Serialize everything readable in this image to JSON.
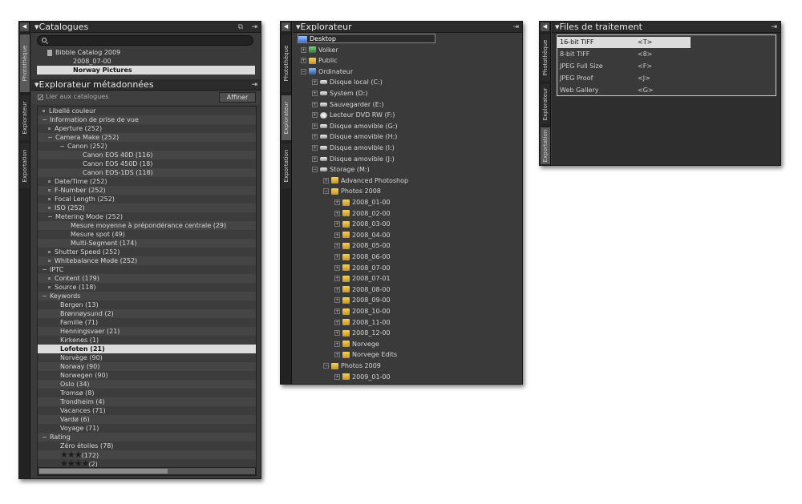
{
  "colors": {
    "panel_bg": "#3a3a3a",
    "header_bg": "#2b2b2b",
    "selection": "#dcdcdc",
    "folder": "#e8b63c"
  },
  "icons": {
    "collapse": "◀",
    "pin": "⇥",
    "copy": "⧉",
    "search": "magnifier"
  },
  "sidetabs": {
    "phototheque": "Photothèque",
    "explorateur": "Explorateur",
    "exportation": "Exportation"
  },
  "catalogues": {
    "title": "Catalogues",
    "items": [
      {
        "label": "Bibble Catalog 2009"
      },
      {
        "label": "2008_07-00"
      },
      {
        "label": "Norway Pictures",
        "selected": true
      }
    ]
  },
  "metadata": {
    "title": "Explorateur métadonnées",
    "link_label": "Lier aux catalogues",
    "refine_label": "Affiner",
    "rows": [
      {
        "label": "Libellé couleur",
        "level": 0,
        "marker": "bullet"
      },
      {
        "label": "Information de prise de vue",
        "level": 0,
        "marker": "minus"
      },
      {
        "label": "Aperture (252)",
        "level": 1,
        "marker": "bullet"
      },
      {
        "label": "Camera Make (252)",
        "level": 1,
        "marker": "minus"
      },
      {
        "label": "Canon (252)",
        "level": 2,
        "marker": "minus"
      },
      {
        "label": "Canon EOS 40D (116)",
        "level": 3,
        "marker": ""
      },
      {
        "label": "Canon EOS 450D (18)",
        "level": 3,
        "marker": ""
      },
      {
        "label": "Canon EOS-1DS (118)",
        "level": 3,
        "marker": ""
      },
      {
        "label": "Date/Time (252)",
        "level": 1,
        "marker": "bullet"
      },
      {
        "label": "F-Number (252)",
        "level": 1,
        "marker": "bullet"
      },
      {
        "label": "Focal Length (252)",
        "level": 1,
        "marker": "bullet"
      },
      {
        "label": "ISO (252)",
        "level": 1,
        "marker": "bullet"
      },
      {
        "label": "Metering Mode (252)",
        "level": 1,
        "marker": "minus"
      },
      {
        "label": "Mesure moyenne à prépondérance centrale (29)",
        "level": 2,
        "marker": ""
      },
      {
        "label": "Mesure spot (49)",
        "level": 2,
        "marker": ""
      },
      {
        "label": "Multi-Segment (174)",
        "level": 2,
        "marker": ""
      },
      {
        "label": "Shutter Speed (252)",
        "level": 1,
        "marker": "bullet"
      },
      {
        "label": "Whitebalance Mode (252)",
        "level": 1,
        "marker": "bullet"
      },
      {
        "label": "IPTC",
        "level": 0,
        "marker": "minus"
      },
      {
        "label": "Content (179)",
        "level": 1,
        "marker": "bullet"
      },
      {
        "label": "Source (118)",
        "level": 1,
        "marker": "bullet"
      },
      {
        "label": "Keywords",
        "level": 0,
        "marker": "minus"
      },
      {
        "label": "Bergen (13)",
        "level": 1,
        "marker": ""
      },
      {
        "label": "Brønnøysund (2)",
        "level": 1,
        "marker": ""
      },
      {
        "label": "Famille (71)",
        "level": 1,
        "marker": ""
      },
      {
        "label": "Henningsvaer (21)",
        "level": 1,
        "marker": ""
      },
      {
        "label": "Kirkenes (1)",
        "level": 1,
        "marker": ""
      },
      {
        "label": "Lofoten (21)",
        "level": 1,
        "marker": "",
        "selected": true
      },
      {
        "label": "Norvège (90)",
        "level": 1,
        "marker": ""
      },
      {
        "label": "Norway (90)",
        "level": 1,
        "marker": ""
      },
      {
        "label": "Norwegen (90)",
        "level": 1,
        "marker": ""
      },
      {
        "label": "Oslo (34)",
        "level": 1,
        "marker": ""
      },
      {
        "label": "Tromsø (8)",
        "level": 1,
        "marker": ""
      },
      {
        "label": "Trondheim (4)",
        "level": 1,
        "marker": ""
      },
      {
        "label": "Vacances (71)",
        "level": 1,
        "marker": ""
      },
      {
        "label": "Vardø (6)",
        "level": 1,
        "marker": ""
      },
      {
        "label": "Voyage (71)",
        "level": 1,
        "marker": ""
      },
      {
        "label": "Rating",
        "level": 0,
        "marker": "minus"
      },
      {
        "label": "Zéro étoiles (78)",
        "level": 1,
        "marker": ""
      },
      {
        "label": "(172)",
        "level": 1,
        "marker": "",
        "stars": 3
      },
      {
        "label": "(2)",
        "level": 1,
        "marker": "",
        "stars": 4
      }
    ]
  },
  "explorer": {
    "title": "Explorateur",
    "items": [
      {
        "label": "Desktop",
        "depth": 0,
        "icon": "desk",
        "toggle": "",
        "selected": true
      },
      {
        "label": "Volker",
        "depth": 1,
        "icon": "user",
        "toggle": "+"
      },
      {
        "label": "Public",
        "depth": 1,
        "icon": "folder",
        "toggle": "+"
      },
      {
        "label": "Ordinateur",
        "depth": 1,
        "icon": "pc",
        "toggle": "-"
      },
      {
        "label": "Disque local (C:)",
        "depth": 2,
        "icon": "drive",
        "toggle": "+"
      },
      {
        "label": "System (D:)",
        "depth": 2,
        "icon": "drive",
        "toggle": "+"
      },
      {
        "label": "Sauvegarder (E:)",
        "depth": 2,
        "icon": "drive",
        "toggle": "+"
      },
      {
        "label": "Lecteur DVD RW (F:)",
        "depth": 2,
        "icon": "disc",
        "toggle": "+"
      },
      {
        "label": "Disque amovible (G:)",
        "depth": 2,
        "icon": "drive",
        "toggle": "+"
      },
      {
        "label": "Disque amovible (H:)",
        "depth": 2,
        "icon": "drive",
        "toggle": "+"
      },
      {
        "label": "Disque amovible (I:)",
        "depth": 2,
        "icon": "drive",
        "toggle": "+"
      },
      {
        "label": "Disque amovible (J:)",
        "depth": 2,
        "icon": "drive",
        "toggle": "+"
      },
      {
        "label": "Storage (M:)",
        "depth": 2,
        "icon": "drive",
        "toggle": "-"
      },
      {
        "label": "Advanced Photoshop",
        "depth": 3,
        "icon": "folder",
        "toggle": "+"
      },
      {
        "label": "Photos 2008",
        "depth": 3,
        "icon": "folder",
        "toggle": "-"
      },
      {
        "label": "2008_01-00",
        "depth": 4,
        "icon": "folder",
        "toggle": "+"
      },
      {
        "label": "2008_02-00",
        "depth": 4,
        "icon": "folder",
        "toggle": "+"
      },
      {
        "label": "2008_03-00",
        "depth": 4,
        "icon": "folder",
        "toggle": "+"
      },
      {
        "label": "2008_04-00",
        "depth": 4,
        "icon": "folder",
        "toggle": "+"
      },
      {
        "label": "2008_05-00",
        "depth": 4,
        "icon": "folder",
        "toggle": "+"
      },
      {
        "label": "2008_06-00",
        "depth": 4,
        "icon": "folder",
        "toggle": "+"
      },
      {
        "label": "2008_07-00",
        "depth": 4,
        "icon": "folder",
        "toggle": "+"
      },
      {
        "label": "2008_07-01",
        "depth": 4,
        "icon": "folder",
        "toggle": "+"
      },
      {
        "label": "2008_08-00",
        "depth": 4,
        "icon": "folder",
        "toggle": "+"
      },
      {
        "label": "2008_09-00",
        "depth": 4,
        "icon": "folder",
        "toggle": "+"
      },
      {
        "label": "2008_10-00",
        "depth": 4,
        "icon": "folder",
        "toggle": "+"
      },
      {
        "label": "2008_11-00",
        "depth": 4,
        "icon": "folder",
        "toggle": "+"
      },
      {
        "label": "2008_12-00",
        "depth": 4,
        "icon": "folder",
        "toggle": "+"
      },
      {
        "label": "Norvege",
        "depth": 4,
        "icon": "folder",
        "toggle": "+"
      },
      {
        "label": "Norvege Edits",
        "depth": 4,
        "icon": "folder",
        "toggle": "+"
      },
      {
        "label": "Photos 2009",
        "depth": 3,
        "icon": "folder",
        "toggle": "-"
      },
      {
        "label": "2009_01-00",
        "depth": 4,
        "icon": "folder",
        "toggle": "+"
      }
    ]
  },
  "process_files": {
    "title": "Files de traitement",
    "items": [
      {
        "name": "16-bit TIFF",
        "key": "<T>",
        "selected": true
      },
      {
        "name": "8-bit TIFF",
        "key": "<8>"
      },
      {
        "name": "JPEG Full Size",
        "key": "<F>"
      },
      {
        "name": "JPEG Proof",
        "key": "<J>"
      },
      {
        "name": "Web Gallery",
        "key": "<G>"
      }
    ]
  }
}
